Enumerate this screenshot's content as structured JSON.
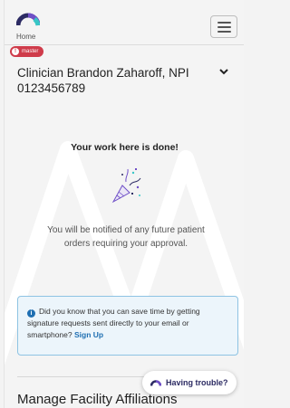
{
  "header": {
    "home_label": "Home",
    "logo_icon": "brand-arc-logo",
    "menu_icon": "hamburger-menu-icon"
  },
  "badge": {
    "label": "master",
    "icon": "alert-circle-icon",
    "color": "#cf3b4a"
  },
  "clinician": {
    "title": "Clinician Brandon Zaharoff, NPI 0123456789",
    "toggle_icon": "chevron-down-icon"
  },
  "main": {
    "heading": "Your work here is done!",
    "illustration_icon": "party-popper-icon",
    "notify_line1": "You will be notified of any future patient",
    "notify_line2": "orders requiring your approval."
  },
  "info": {
    "icon": "info-circle-icon",
    "text": "Did you know that you can save time by getting signature requests sent directly to your email or smartphone?",
    "link": "Sign Up"
  },
  "section": {
    "title": "Manage Facility Affiliations"
  },
  "help": {
    "label": "Having trouble?",
    "icon": "brand-arc-logo"
  },
  "colors": {
    "brand_navy": "#2c2b63",
    "brand_purple": "#6f4fc7",
    "brand_teal": "#38c6c6",
    "link_blue": "#1f6fb2",
    "info_bg": "#ecf5fb",
    "info_border": "#8ec3e3"
  }
}
